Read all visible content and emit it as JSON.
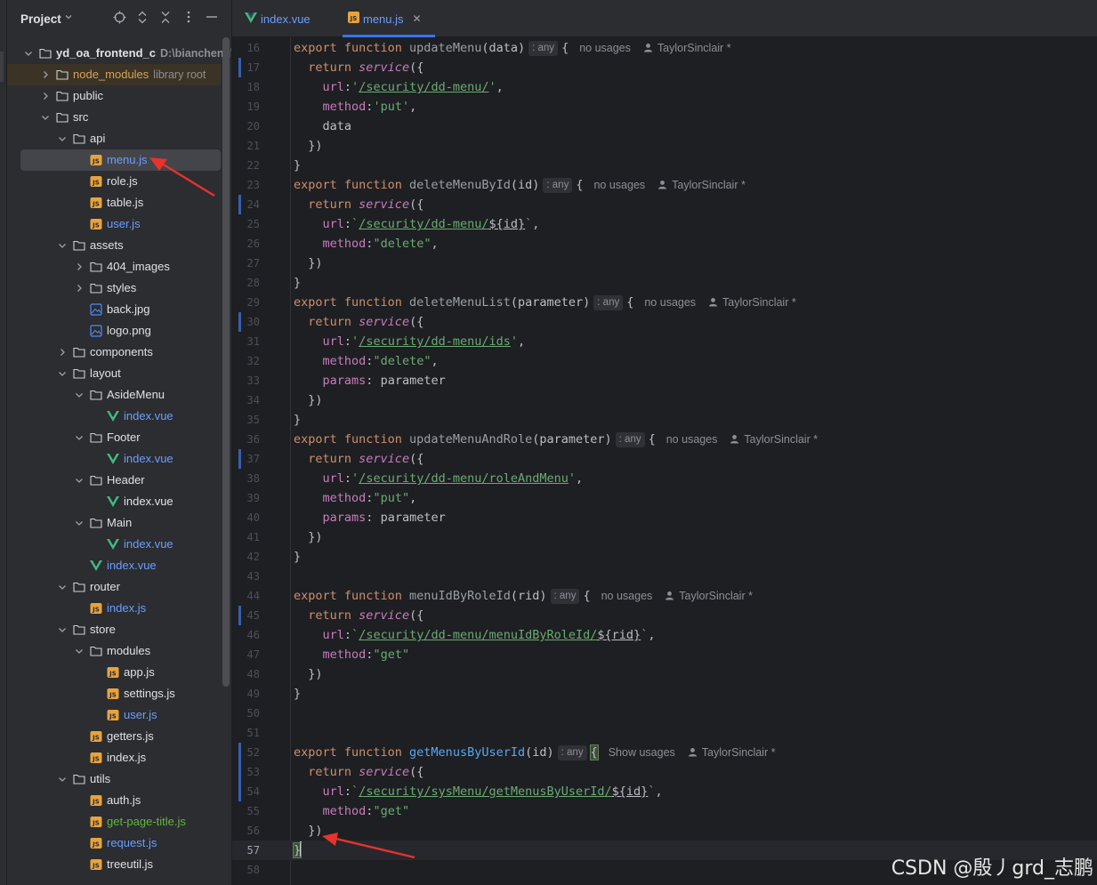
{
  "project_panel": {
    "title": "Project",
    "tree": [
      {
        "name": "yd_oa_frontend_c",
        "suffix": "D:\\biancheng\\",
        "kind": "root",
        "depth": 0,
        "expanded": true
      },
      {
        "name": "node_modules",
        "suffix": "library root",
        "kind": "folder",
        "depth": 1,
        "expanded": false,
        "excluded": true
      },
      {
        "name": "public",
        "kind": "folder",
        "depth": 1,
        "expanded": false
      },
      {
        "name": "src",
        "kind": "folder",
        "depth": 1,
        "expanded": true
      },
      {
        "name": "api",
        "kind": "folder",
        "depth": 2,
        "expanded": true
      },
      {
        "name": "menu.js",
        "kind": "js",
        "depth": 3,
        "status": "selected"
      },
      {
        "name": "role.js",
        "kind": "js",
        "depth": 3
      },
      {
        "name": "table.js",
        "kind": "js",
        "depth": 3
      },
      {
        "name": "user.js",
        "kind": "js",
        "depth": 3,
        "status": "modified"
      },
      {
        "name": "assets",
        "kind": "folder",
        "depth": 2,
        "expanded": true
      },
      {
        "name": "404_images",
        "kind": "folder",
        "depth": 3,
        "expanded": false
      },
      {
        "name": "styles",
        "kind": "folder",
        "depth": 3,
        "expanded": false
      },
      {
        "name": "back.jpg",
        "kind": "image",
        "depth": 3
      },
      {
        "name": "logo.png",
        "kind": "image",
        "depth": 3
      },
      {
        "name": "components",
        "kind": "folder",
        "depth": 2,
        "expanded": false
      },
      {
        "name": "layout",
        "kind": "folder",
        "depth": 2,
        "expanded": true
      },
      {
        "name": "AsideMenu",
        "kind": "folder",
        "depth": 3,
        "expanded": true
      },
      {
        "name": "index.vue",
        "kind": "vue",
        "depth": 4,
        "status": "modified"
      },
      {
        "name": "Footer",
        "kind": "folder",
        "depth": 3,
        "expanded": true
      },
      {
        "name": "index.vue",
        "kind": "vue",
        "depth": 4,
        "status": "modified"
      },
      {
        "name": "Header",
        "kind": "folder",
        "depth": 3,
        "expanded": true
      },
      {
        "name": "index.vue",
        "kind": "vue",
        "depth": 4
      },
      {
        "name": "Main",
        "kind": "folder",
        "depth": 3,
        "expanded": true
      },
      {
        "name": "index.vue",
        "kind": "vue",
        "depth": 4,
        "status": "modified"
      },
      {
        "name": "index.vue",
        "kind": "vue",
        "depth": 3,
        "status": "modified"
      },
      {
        "name": "router",
        "kind": "folder",
        "depth": 2,
        "expanded": true
      },
      {
        "name": "index.js",
        "kind": "js",
        "depth": 3,
        "status": "modified"
      },
      {
        "name": "store",
        "kind": "folder",
        "depth": 2,
        "expanded": true
      },
      {
        "name": "modules",
        "kind": "folder",
        "depth": 3,
        "expanded": true
      },
      {
        "name": "app.js",
        "kind": "js",
        "depth": 4
      },
      {
        "name": "settings.js",
        "kind": "js",
        "depth": 4
      },
      {
        "name": "user.js",
        "kind": "js",
        "depth": 4,
        "status": "modified"
      },
      {
        "name": "getters.js",
        "kind": "js",
        "depth": 3
      },
      {
        "name": "index.js",
        "kind": "js",
        "depth": 3
      },
      {
        "name": "utils",
        "kind": "folder",
        "depth": 2,
        "expanded": true
      },
      {
        "name": "auth.js",
        "kind": "js",
        "depth": 3
      },
      {
        "name": "get-page-title.js",
        "kind": "js",
        "depth": 3,
        "status": "added"
      },
      {
        "name": "request.js",
        "kind": "js",
        "depth": 3,
        "status": "modified"
      },
      {
        "name": "treeutil.js",
        "kind": "js",
        "depth": 3
      }
    ]
  },
  "tabs": [
    {
      "label": "index.vue",
      "kind": "vue",
      "active": false
    },
    {
      "label": "menu.js",
      "kind": "js",
      "active": true
    }
  ],
  "editor": {
    "author": "TaylorSinclair *",
    "no_usages": "no usages",
    "show_usages": "Show usages",
    "type_hint": ": any",
    "current_line": 57,
    "lines": [
      {
        "n": 16,
        "t": "fn",
        "name": "updateMenu",
        "param": "data",
        "usages": "no"
      },
      {
        "n": 17,
        "t": "ret"
      },
      {
        "n": 18,
        "t": "url",
        "q": "'",
        "url": "/security/dd-menu/",
        "tail": ","
      },
      {
        "n": 19,
        "t": "method",
        "m": "'put'",
        "tail": ","
      },
      {
        "n": 20,
        "t": "raw",
        "text": "    data"
      },
      {
        "n": 21,
        "t": "raw",
        "text": "  })"
      },
      {
        "n": 22,
        "t": "raw",
        "text": "}"
      },
      {
        "n": 23,
        "t": "fn",
        "name": "deleteMenuById",
        "param": "id",
        "usages": "no"
      },
      {
        "n": 24,
        "t": "ret"
      },
      {
        "n": 25,
        "t": "url",
        "q": "`",
        "url": "/security/dd-menu/",
        "var": "${id}",
        "tail": ","
      },
      {
        "n": 26,
        "t": "method",
        "m": "\"delete\"",
        "tail": ","
      },
      {
        "n": 27,
        "t": "raw",
        "text": "  })"
      },
      {
        "n": 28,
        "t": "raw",
        "text": "}"
      },
      {
        "n": 29,
        "t": "fn",
        "name": "deleteMenuList",
        "param": "parameter",
        "usages": "no"
      },
      {
        "n": 30,
        "t": "ret"
      },
      {
        "n": 31,
        "t": "url",
        "q": "'",
        "url": "/security/dd-menu/ids",
        "tail": ","
      },
      {
        "n": 32,
        "t": "method",
        "m": "\"delete\"",
        "tail": ","
      },
      {
        "n": 33,
        "t": "params",
        "text": "parameter"
      },
      {
        "n": 34,
        "t": "raw",
        "text": "  })"
      },
      {
        "n": 35,
        "t": "raw",
        "text": "}"
      },
      {
        "n": 36,
        "t": "fn",
        "name": "updateMenuAndRole",
        "param": "parameter",
        "usages": "no"
      },
      {
        "n": 37,
        "t": "ret"
      },
      {
        "n": 38,
        "t": "url",
        "q": "'",
        "url": "/security/dd-menu/roleAndMenu",
        "tail": ","
      },
      {
        "n": 39,
        "t": "method",
        "m": "\"put\"",
        "tail": ","
      },
      {
        "n": 40,
        "t": "params",
        "text": "parameter"
      },
      {
        "n": 41,
        "t": "raw",
        "text": "  })"
      },
      {
        "n": 42,
        "t": "raw",
        "text": "}"
      },
      {
        "n": 43,
        "t": "raw",
        "text": ""
      },
      {
        "n": 44,
        "t": "fn",
        "name": "menuIdByRoleId",
        "param": "rid",
        "usages": "no"
      },
      {
        "n": 45,
        "t": "ret"
      },
      {
        "n": 46,
        "t": "url",
        "q": "`",
        "url": "/security/dd-menu/menuIdByRoleId/",
        "var": "${rid}",
        "tail": ","
      },
      {
        "n": 47,
        "t": "method",
        "m": "\"get\"",
        "tail": ""
      },
      {
        "n": 48,
        "t": "raw",
        "text": "  })"
      },
      {
        "n": 49,
        "t": "raw",
        "text": "}"
      },
      {
        "n": 50,
        "t": "raw",
        "text": ""
      },
      {
        "n": 51,
        "t": "raw",
        "text": ""
      },
      {
        "n": 52,
        "t": "fn",
        "name": "getMenusByUserId",
        "param": "id",
        "usages": "show",
        "active": true
      },
      {
        "n": 53,
        "t": "ret"
      },
      {
        "n": 54,
        "t": "url",
        "q": "`",
        "url": "/security/sysMenu/getMenusByUserId/",
        "var": "${id}",
        "tail": ","
      },
      {
        "n": 55,
        "t": "method",
        "m": "\"get\"",
        "tail": ""
      },
      {
        "n": 56,
        "t": "raw",
        "text": "  })"
      },
      {
        "n": 57,
        "t": "close"
      },
      {
        "n": 58,
        "t": "raw",
        "text": ""
      }
    ]
  },
  "watermark": "CSDN @殷丿grd_志鹏",
  "colors": {
    "accent": "#3574f0",
    "annotation_arrow": "#e8322d",
    "keyword": "#cf8e6d",
    "string": "#6aab73",
    "function": "#56a8f5"
  }
}
